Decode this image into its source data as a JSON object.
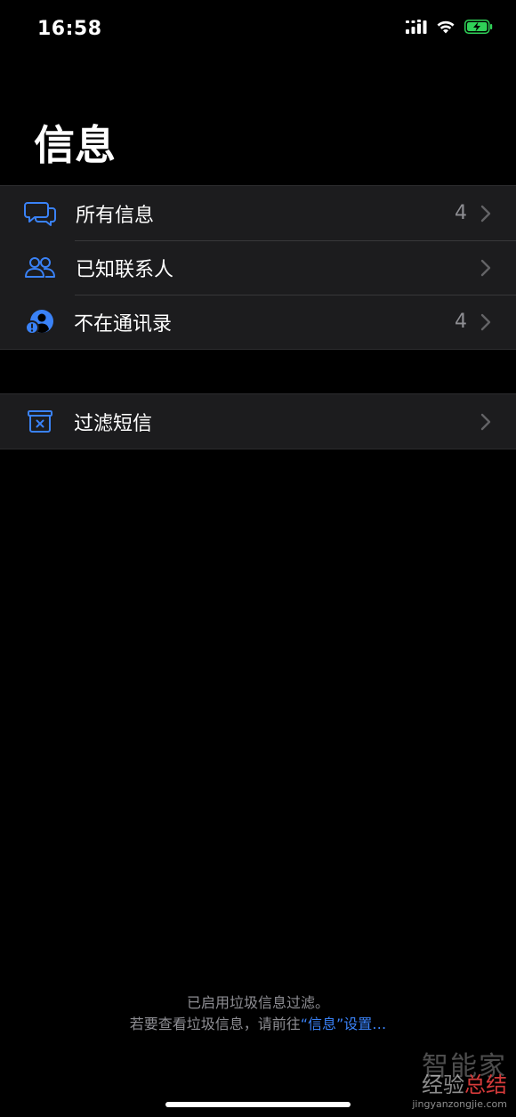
{
  "status_bar": {
    "time": "16:58",
    "icons": [
      "cellular-signal-icon",
      "wifi-icon",
      "battery-charging-icon"
    ]
  },
  "title": "信息",
  "filters": [
    {
      "label": "所有信息",
      "count": "4",
      "icon": "chat-bubbles-icon"
    },
    {
      "label": "已知联系人",
      "count": "",
      "icon": "people-icon"
    },
    {
      "label": "不在通讯录",
      "count": "4",
      "icon": "unknown-person-icon"
    }
  ],
  "junk": {
    "label": "过滤短信",
    "icon": "junk-box-icon"
  },
  "footer": {
    "line1": "已启用垃圾信息过滤。",
    "line2_prefix": "若要查看垃圾信息，请前往",
    "line2_link": "“信息”设置…"
  },
  "watermark": {
    "top": "智能家",
    "main_a": "经验",
    "main_b": "总结",
    "url": "jingyanzongjie.com"
  },
  "colors": {
    "accent": "#3a82f7",
    "background": "#000000",
    "cell": "#1c1c1e",
    "secondary_text": "#8e8e93",
    "battery": "#30d158"
  }
}
